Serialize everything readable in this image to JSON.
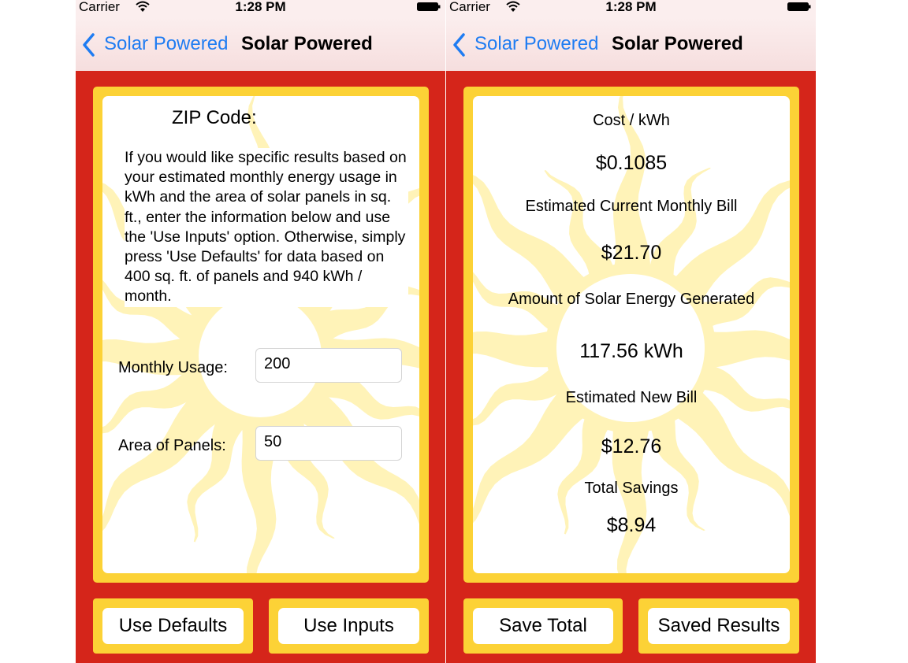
{
  "colors": {
    "background_red": "#d5251a",
    "frame_yellow": "#fcd236",
    "sun_yellow": "#fff3b8",
    "nav_link_blue": "#1f7cf2"
  },
  "left_screen": {
    "status_bar": {
      "carrier": "Carrier",
      "time": "1:28 PM",
      "wifi_icon": "wifi-icon",
      "battery_icon": "battery-icon"
    },
    "nav": {
      "back_label": "Solar Powered",
      "title": "Solar Powered",
      "back_icon": "chevron-left-icon"
    },
    "card": {
      "zip_label": "ZIP Code:",
      "info_text": "If you would like specific results based on your estimated monthly energy usage in kWh and the area of solar panels in sq. ft., enter the information below and use the 'Use Inputs' option.  Otherwise, simply press 'Use Defaults' for data based on 400 sq. ft. of panels and 940 kWh / month.",
      "monthly_usage_label": "Monthly Usage:",
      "monthly_usage_value": "200",
      "area_label": "Area of Panels:",
      "area_value": "50"
    },
    "buttons": {
      "use_defaults": "Use Defaults",
      "use_inputs": "Use Inputs"
    }
  },
  "right_screen": {
    "status_bar": {
      "carrier": "Carrier",
      "time": "1:28 PM",
      "wifi_icon": "wifi-icon",
      "battery_icon": "battery-icon"
    },
    "nav": {
      "back_label": "Solar Powered",
      "title": "Solar Powered",
      "back_icon": "chevron-left-icon"
    },
    "results": {
      "cost_label": "Cost / kWh",
      "cost_value": "$0.1085",
      "current_bill_label": "Estimated Current Monthly Bill",
      "current_bill_value": "$21.70",
      "energy_label": "Amount of Solar Energy Generated",
      "energy_value": "117.56 kWh",
      "new_bill_label": "Estimated New Bill",
      "new_bill_value": "$12.76",
      "savings_label": "Total Savings",
      "savings_value": "$8.94"
    },
    "buttons": {
      "save_total": "Save Total",
      "saved_results": "Saved Results"
    }
  }
}
